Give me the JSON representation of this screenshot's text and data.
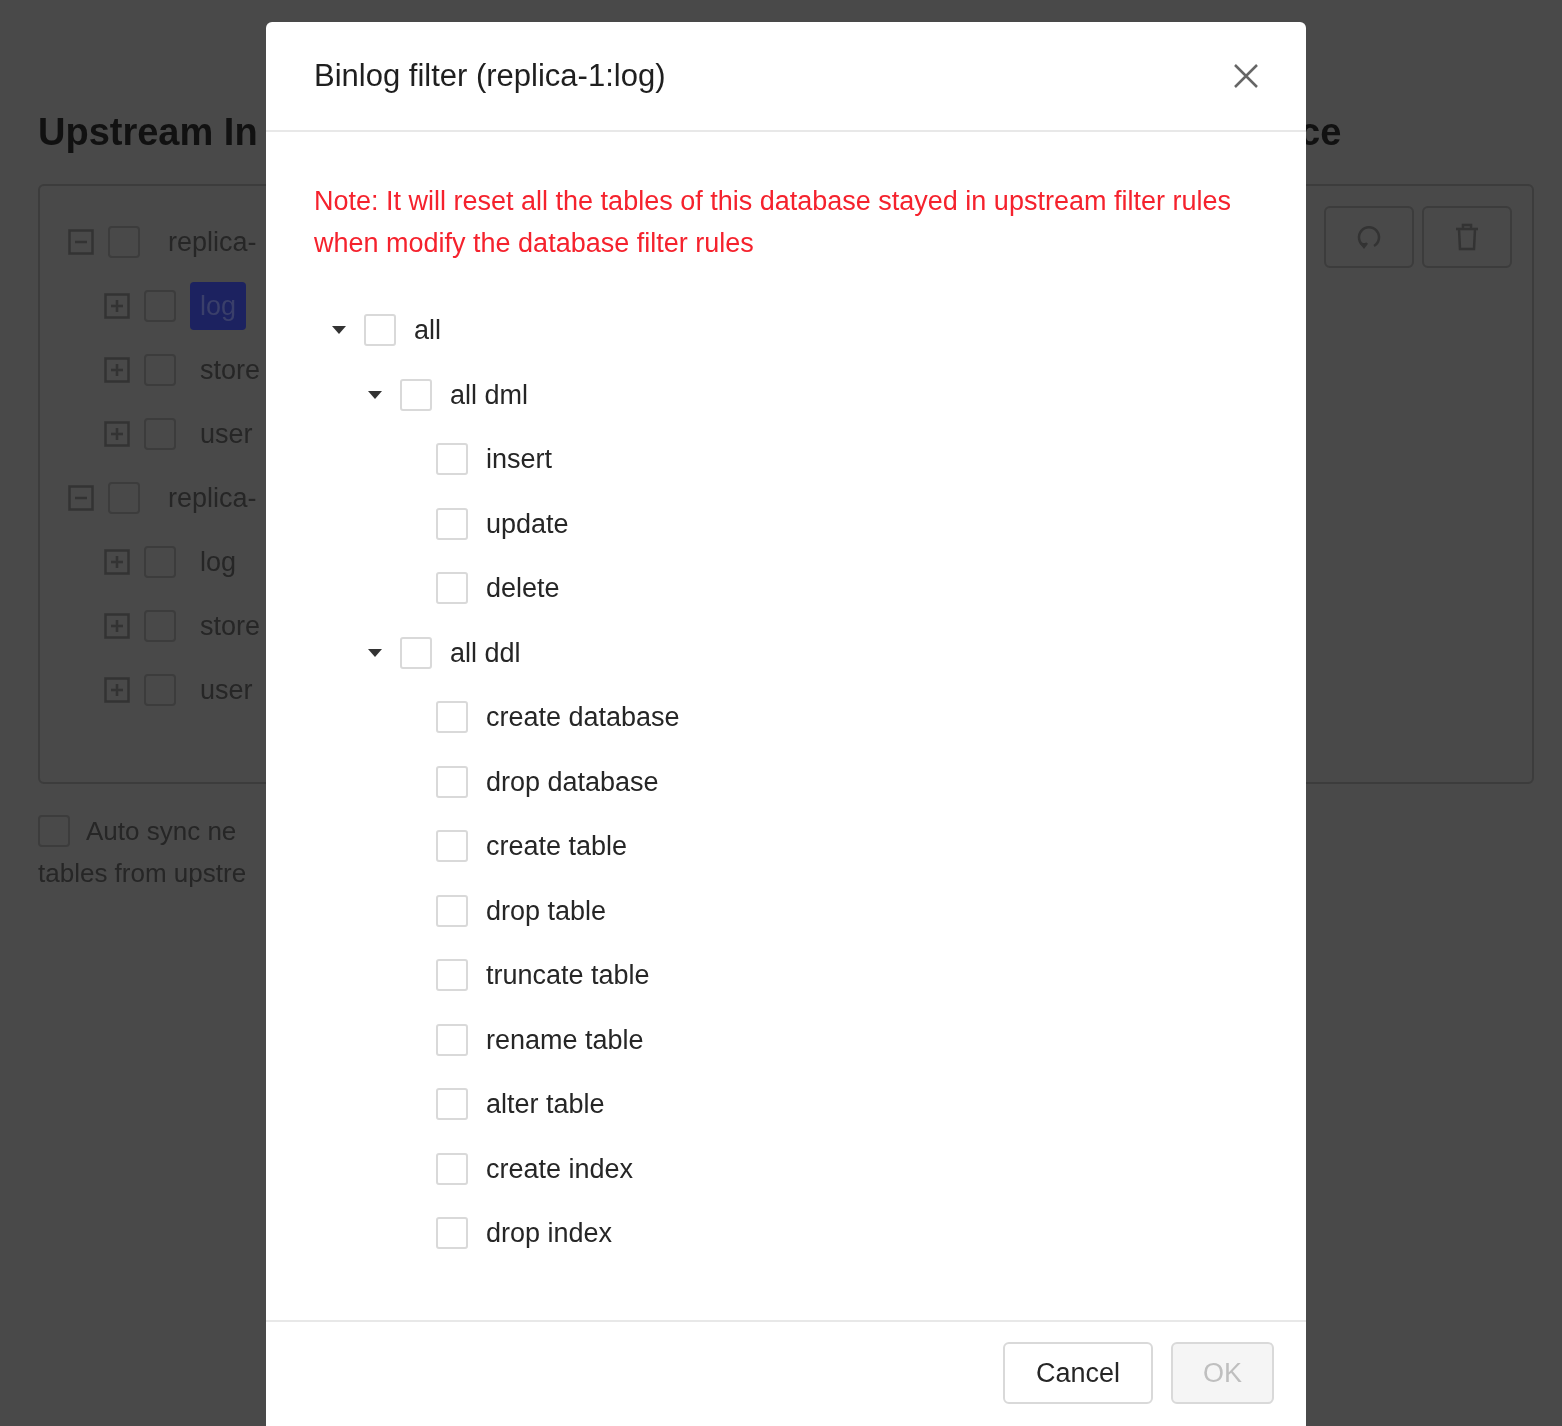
{
  "page": {
    "heading_left": "Upstream In",
    "heading_right": "ce",
    "tree": [
      {
        "label": "replica-",
        "expanded": true,
        "checked": false,
        "selected": false,
        "children": [
          {
            "label": "log",
            "expanded": false,
            "checked": false,
            "selected": true
          },
          {
            "label": "store",
            "expanded": false,
            "checked": false,
            "selected": false
          },
          {
            "label": "user",
            "expanded": false,
            "checked": false,
            "selected": false
          }
        ]
      },
      {
        "label": "replica-",
        "expanded": true,
        "checked": false,
        "selected": false,
        "children": [
          {
            "label": "log",
            "expanded": false,
            "checked": false,
            "selected": false
          },
          {
            "label": "store",
            "expanded": false,
            "checked": false,
            "selected": false
          },
          {
            "label": "user",
            "expanded": false,
            "checked": false,
            "selected": false
          }
        ]
      }
    ],
    "auto_sync": {
      "checked": false,
      "lines": [
        "Auto sync ne",
        "tables from upstre"
      ]
    }
  },
  "dialog": {
    "title": "Binlog filter (replica-1:log)",
    "note": "Note: It will reset all the tables of this database stayed in upstream filter rules when modify the database filter rules",
    "tree": [
      {
        "label": "all",
        "expanded": true,
        "checked": false,
        "children": [
          {
            "label": "all dml",
            "expanded": true,
            "checked": false,
            "children": [
              {
                "label": "insert",
                "checked": false
              },
              {
                "label": "update",
                "checked": false
              },
              {
                "label": "delete",
                "checked": false
              }
            ]
          },
          {
            "label": "all ddl",
            "expanded": true,
            "checked": false,
            "children": [
              {
                "label": "create database",
                "checked": false
              },
              {
                "label": "drop database",
                "checked": false
              },
              {
                "label": "create table",
                "checked": false
              },
              {
                "label": "drop table",
                "checked": false
              },
              {
                "label": "truncate table",
                "checked": false
              },
              {
                "label": "rename table",
                "checked": false
              },
              {
                "label": "alter table",
                "checked": false
              },
              {
                "label": "create index",
                "checked": false
              },
              {
                "label": "drop index",
                "checked": false
              }
            ]
          }
        ]
      }
    ],
    "buttons": [
      {
        "label": "Cancel",
        "disabled": false
      },
      {
        "label": "OK",
        "disabled": true
      }
    ]
  }
}
